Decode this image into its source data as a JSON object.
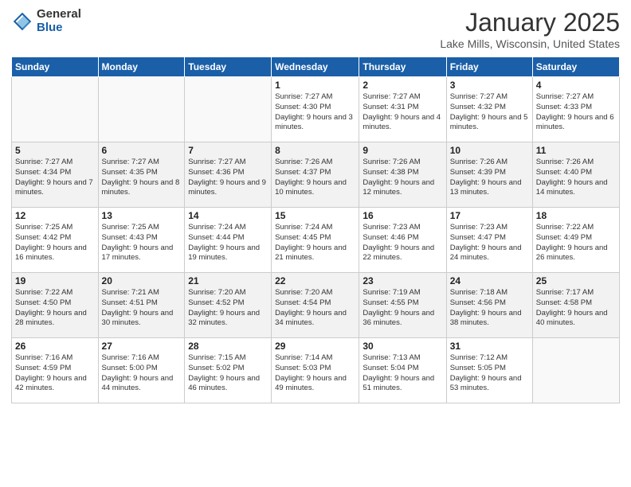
{
  "logo": {
    "general": "General",
    "blue": "Blue"
  },
  "header": {
    "month": "January 2025",
    "location": "Lake Mills, Wisconsin, United States"
  },
  "weekdays": [
    "Sunday",
    "Monday",
    "Tuesday",
    "Wednesday",
    "Thursday",
    "Friday",
    "Saturday"
  ],
  "weeks": [
    [
      {
        "day": "",
        "info": ""
      },
      {
        "day": "",
        "info": ""
      },
      {
        "day": "",
        "info": ""
      },
      {
        "day": "1",
        "info": "Sunrise: 7:27 AM\nSunset: 4:30 PM\nDaylight: 9 hours and 3 minutes."
      },
      {
        "day": "2",
        "info": "Sunrise: 7:27 AM\nSunset: 4:31 PM\nDaylight: 9 hours and 4 minutes."
      },
      {
        "day": "3",
        "info": "Sunrise: 7:27 AM\nSunset: 4:32 PM\nDaylight: 9 hours and 5 minutes."
      },
      {
        "day": "4",
        "info": "Sunrise: 7:27 AM\nSunset: 4:33 PM\nDaylight: 9 hours and 6 minutes."
      }
    ],
    [
      {
        "day": "5",
        "info": "Sunrise: 7:27 AM\nSunset: 4:34 PM\nDaylight: 9 hours and 7 minutes."
      },
      {
        "day": "6",
        "info": "Sunrise: 7:27 AM\nSunset: 4:35 PM\nDaylight: 9 hours and 8 minutes."
      },
      {
        "day": "7",
        "info": "Sunrise: 7:27 AM\nSunset: 4:36 PM\nDaylight: 9 hours and 9 minutes."
      },
      {
        "day": "8",
        "info": "Sunrise: 7:26 AM\nSunset: 4:37 PM\nDaylight: 9 hours and 10 minutes."
      },
      {
        "day": "9",
        "info": "Sunrise: 7:26 AM\nSunset: 4:38 PM\nDaylight: 9 hours and 12 minutes."
      },
      {
        "day": "10",
        "info": "Sunrise: 7:26 AM\nSunset: 4:39 PM\nDaylight: 9 hours and 13 minutes."
      },
      {
        "day": "11",
        "info": "Sunrise: 7:26 AM\nSunset: 4:40 PM\nDaylight: 9 hours and 14 minutes."
      }
    ],
    [
      {
        "day": "12",
        "info": "Sunrise: 7:25 AM\nSunset: 4:42 PM\nDaylight: 9 hours and 16 minutes."
      },
      {
        "day": "13",
        "info": "Sunrise: 7:25 AM\nSunset: 4:43 PM\nDaylight: 9 hours and 17 minutes."
      },
      {
        "day": "14",
        "info": "Sunrise: 7:24 AM\nSunset: 4:44 PM\nDaylight: 9 hours and 19 minutes."
      },
      {
        "day": "15",
        "info": "Sunrise: 7:24 AM\nSunset: 4:45 PM\nDaylight: 9 hours and 21 minutes."
      },
      {
        "day": "16",
        "info": "Sunrise: 7:23 AM\nSunset: 4:46 PM\nDaylight: 9 hours and 22 minutes."
      },
      {
        "day": "17",
        "info": "Sunrise: 7:23 AM\nSunset: 4:47 PM\nDaylight: 9 hours and 24 minutes."
      },
      {
        "day": "18",
        "info": "Sunrise: 7:22 AM\nSunset: 4:49 PM\nDaylight: 9 hours and 26 minutes."
      }
    ],
    [
      {
        "day": "19",
        "info": "Sunrise: 7:22 AM\nSunset: 4:50 PM\nDaylight: 9 hours and 28 minutes."
      },
      {
        "day": "20",
        "info": "Sunrise: 7:21 AM\nSunset: 4:51 PM\nDaylight: 9 hours and 30 minutes."
      },
      {
        "day": "21",
        "info": "Sunrise: 7:20 AM\nSunset: 4:52 PM\nDaylight: 9 hours and 32 minutes."
      },
      {
        "day": "22",
        "info": "Sunrise: 7:20 AM\nSunset: 4:54 PM\nDaylight: 9 hours and 34 minutes."
      },
      {
        "day": "23",
        "info": "Sunrise: 7:19 AM\nSunset: 4:55 PM\nDaylight: 9 hours and 36 minutes."
      },
      {
        "day": "24",
        "info": "Sunrise: 7:18 AM\nSunset: 4:56 PM\nDaylight: 9 hours and 38 minutes."
      },
      {
        "day": "25",
        "info": "Sunrise: 7:17 AM\nSunset: 4:58 PM\nDaylight: 9 hours and 40 minutes."
      }
    ],
    [
      {
        "day": "26",
        "info": "Sunrise: 7:16 AM\nSunset: 4:59 PM\nDaylight: 9 hours and 42 minutes."
      },
      {
        "day": "27",
        "info": "Sunrise: 7:16 AM\nSunset: 5:00 PM\nDaylight: 9 hours and 44 minutes."
      },
      {
        "day": "28",
        "info": "Sunrise: 7:15 AM\nSunset: 5:02 PM\nDaylight: 9 hours and 46 minutes."
      },
      {
        "day": "29",
        "info": "Sunrise: 7:14 AM\nSunset: 5:03 PM\nDaylight: 9 hours and 49 minutes."
      },
      {
        "day": "30",
        "info": "Sunrise: 7:13 AM\nSunset: 5:04 PM\nDaylight: 9 hours and 51 minutes."
      },
      {
        "day": "31",
        "info": "Sunrise: 7:12 AM\nSunset: 5:05 PM\nDaylight: 9 hours and 53 minutes."
      },
      {
        "day": "",
        "info": ""
      }
    ]
  ]
}
